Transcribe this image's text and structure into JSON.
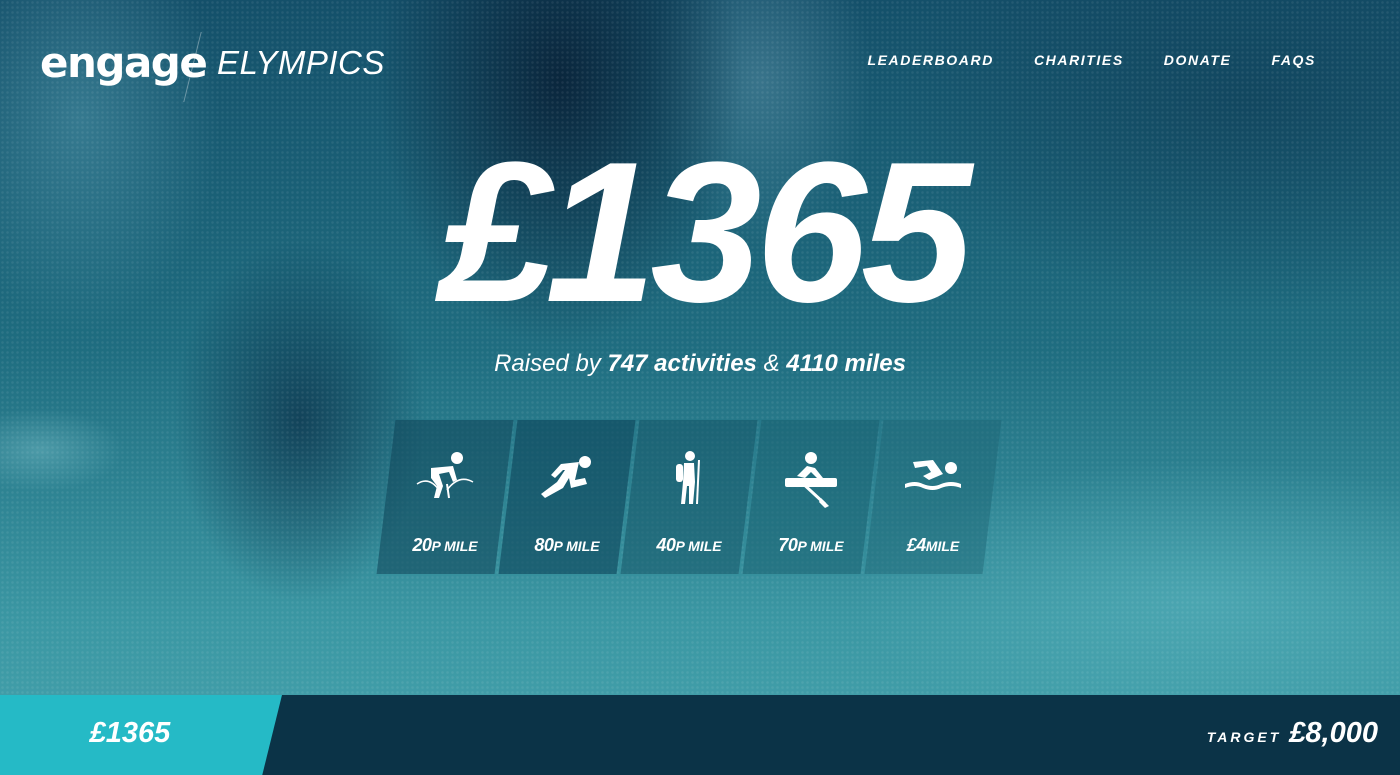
{
  "brand": {
    "logo": "engage",
    "subbrand": "ELYMPICS"
  },
  "nav": [
    {
      "label": "LEADERBOARD"
    },
    {
      "label": "CHARITIES"
    },
    {
      "label": "DONATE"
    },
    {
      "label": "FAQS"
    }
  ],
  "hero": {
    "amount": "£1365",
    "sub_prefix": "Raised by",
    "activities": "747 activities",
    "amp": "&",
    "miles": "4110 miles"
  },
  "activities": [
    {
      "icon": "cycling-icon",
      "rate": "20",
      "unit": "P MILE"
    },
    {
      "icon": "running-icon",
      "rate": "80",
      "unit": "P MILE"
    },
    {
      "icon": "hiking-icon",
      "rate": "40",
      "unit": "P MILE"
    },
    {
      "icon": "rowing-icon",
      "rate": "70",
      "unit": "P MILE"
    },
    {
      "icon": "swimming-icon",
      "rate": "£4",
      "unit": "MILE"
    }
  ],
  "progress": {
    "raised": "£1365",
    "fraction": 0.171,
    "target_label": "TARGET",
    "target_value": "£8,000",
    "accent": "#25bac6"
  }
}
